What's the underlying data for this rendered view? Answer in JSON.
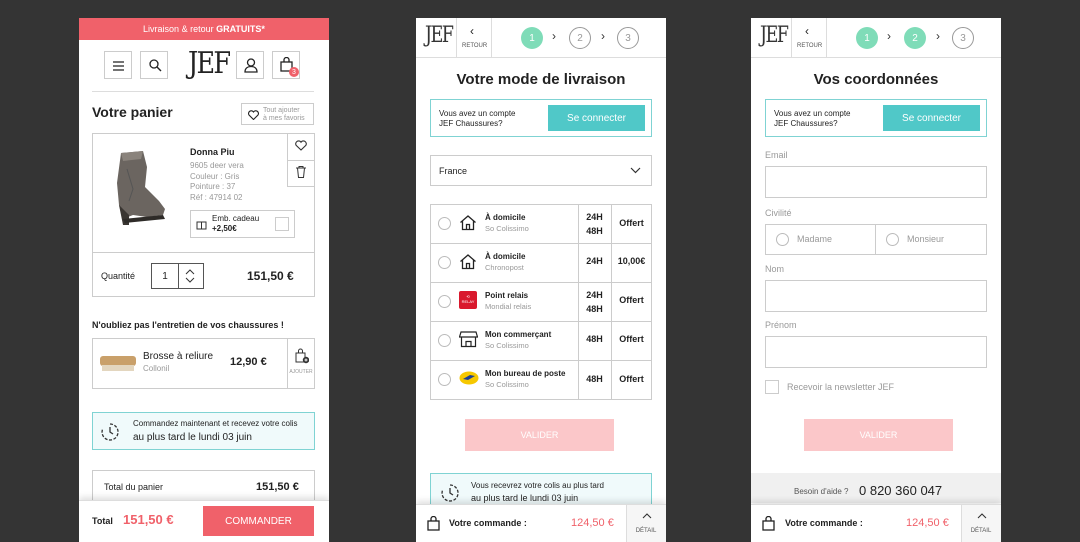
{
  "screen1": {
    "promo": {
      "text": "Livraison & retour ",
      "bold": "GRATUITS*"
    },
    "logo": "JEF",
    "cart_badge": "3",
    "title": "Votre panier",
    "fav_all": "Tout ajouter\nà mes favoris",
    "product": {
      "name": "Donna Piu",
      "ref1": "9605 deer vera",
      "color": "Couleur : Gris",
      "size": "Pointure : 37",
      "ref": "Réf : 47914 02",
      "gift_label": "Emb. cadeau",
      "gift_price": "+2,50€",
      "qty_label": "Quantité",
      "qty": "1",
      "price": "151,50 €"
    },
    "reminder": "N'oubliez pas l'entretien de vos chaussures !",
    "accessory": {
      "name": "Brosse à reliure",
      "brand": "Collonil",
      "price": "12,90 €",
      "add": "AJOUTER"
    },
    "delivery_info_1": "Commandez maintenant et recevez votre colis",
    "delivery_info_2": "au plus tard le lundi 03 juin",
    "total_label": "Total du panier",
    "total_value": "151,50 €",
    "bottom_total_label": "Total",
    "bottom_total_value": "151,50 €",
    "order_button": "COMMANDER"
  },
  "screen2": {
    "logo": "JEF",
    "back": "RETOUR",
    "steps": [
      "1",
      "2",
      "3"
    ],
    "title": "Votre mode de livraison",
    "account_q1": "Vous avez un compte",
    "account_q2": "JEF Chaussures?",
    "connect": "Se connecter",
    "country": "France",
    "options": [
      {
        "name": "À domicile",
        "carrier": "So Colissimo",
        "delay": [
          "24H",
          "48H"
        ],
        "price": "Offert",
        "icon": "house-icon"
      },
      {
        "name": "À domicile",
        "carrier": "Chronopost",
        "delay": [
          "24H"
        ],
        "price": "10,00€",
        "icon": "house-icon"
      },
      {
        "name": "Point relais",
        "carrier": "Mondial relais",
        "delay": [
          "24H",
          "48H"
        ],
        "price": "Offert",
        "icon": "relay-icon"
      },
      {
        "name": "Mon commerçant",
        "carrier": "So Colissimo",
        "delay": [
          "48H"
        ],
        "price": "Offert",
        "icon": "shop-icon"
      },
      {
        "name": "Mon bureau de poste",
        "carrier": "So Colissimo",
        "delay": [
          "48H"
        ],
        "price": "Offert",
        "icon": "laposte-icon"
      }
    ],
    "validate": "VALIDER",
    "delivery_info_1": "Vous recevrez votre colis au plus tard",
    "delivery_info_2": "au plus tard le lundi 03 juin",
    "order_label": "Votre commande :",
    "order_value": "124,50 €",
    "detail": "DÉTAIL"
  },
  "screen3": {
    "logo": "JEF",
    "back": "RETOUR",
    "steps": [
      "1",
      "2",
      "3"
    ],
    "title": "Vos coordonnées",
    "account_q1": "Vous avez un compte",
    "account_q2": "JEF Chaussures?",
    "connect": "Se connecter",
    "email_label": "Email",
    "civility_label": "Civilité",
    "madame": "Madame",
    "monsieur": "Monsieur",
    "name_label": "Nom",
    "firstname_label": "Prénom",
    "newsletter": "Recevoir la newsletter JEF",
    "validate": "VALIDER",
    "help_label": "Besoin d'aide ?",
    "help_phone": "0 820 360 047",
    "order_label": "Votre commande :",
    "order_value": "124,50 €",
    "detail": "DÉTAIL"
  },
  "colors": {
    "accent": "#f0616a",
    "teal": "#50c8c8",
    "step": "#7fdcb8",
    "background": "#343434"
  }
}
